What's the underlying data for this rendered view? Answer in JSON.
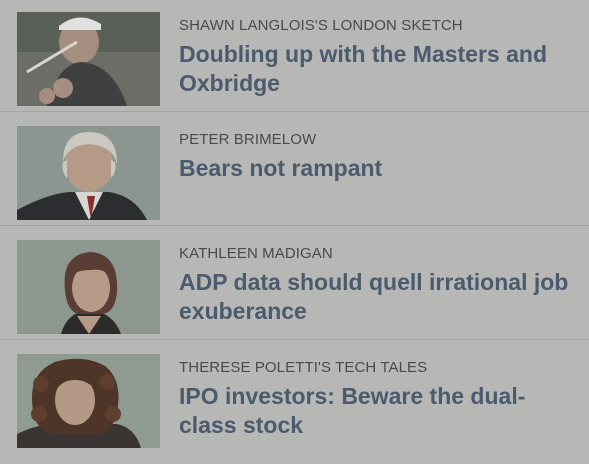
{
  "articles": [
    {
      "kicker": "SHAWN LANGLOIS'S LONDON SKETCH",
      "headline": "Doubling up with the Masters and Oxbridge",
      "thumb_icon": "golfer-photo"
    },
    {
      "kicker": "PETER BRIMELOW",
      "headline": "Bears not rampant",
      "thumb_icon": "author-photo"
    },
    {
      "kicker": "KATHLEEN MADIGAN",
      "headline": "ADP data should quell irrational job exuberance",
      "thumb_icon": "author-photo"
    },
    {
      "kicker": "THERESE POLETTI'S TECH TALES",
      "headline": "IPO investors: Beware the dual-class stock",
      "thumb_icon": "author-photo"
    }
  ],
  "colors": {
    "background": "#b7b7b5",
    "headline": "#4a5b6d",
    "kicker": "#4a4a4a",
    "divider": "#a4a4a2"
  }
}
